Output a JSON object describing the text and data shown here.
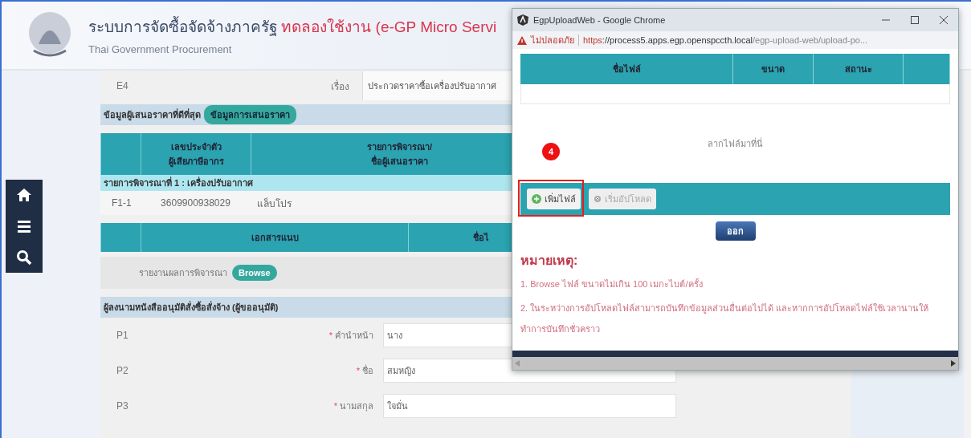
{
  "header": {
    "title": "ระบบการจัดซื้อจัดจ้างภาครัฐ",
    "title_highlight": "ทดลองใช้งาน (e-GP Micro Servi",
    "subtitle": "Thai Government Procurement"
  },
  "subject_row": {
    "code": "E4",
    "label": "เรื่อง",
    "value": "ประกวดราคาซื้อเครื่องปรับอากาศ"
  },
  "bidder_section": {
    "title": "ข้อมูลผู้เสนอราคาที่ดีที่สุด",
    "button": "ข้อมูลการเสนอราคา"
  },
  "bidder_table": {
    "columns": [
      "",
      "เลขประจำตัว\nผู้เสียภาษีอากร",
      "รายการพิจารณา/\nชื่อผู้เสนอราคา"
    ],
    "group": "รายการพิจารณาที่ 1 : เครื่องปรับอากาศ",
    "rows": [
      [
        "F1-1",
        "3609900938029",
        "แล็บโปร"
      ]
    ]
  },
  "attachments": {
    "columns": [
      "",
      "เอกสารแนบ",
      "ชื่อไ"
    ],
    "rows": [
      {
        "label": "รายงานผลการพิจารณา",
        "button": "Browse"
      }
    ]
  },
  "approver": {
    "title": "ผู้ลงนามหนังสืออนุมัติสั่งซื้อสั่งจ้าง (ผู้ขออนุมัติ)",
    "required_mark": "*",
    "fields": [
      {
        "code": "P1",
        "label": "คำนำหน้า",
        "required": true,
        "value": "นาง"
      },
      {
        "code": "P2",
        "label": "ชื่อ",
        "required": true,
        "value": "สมหญิง"
      },
      {
        "code": "P3",
        "label": "นามสกุล",
        "required": true,
        "value": "ใจมั่น"
      }
    ]
  },
  "popup": {
    "title": "EgpUploadWeb - Google Chrome",
    "security": "ไม่ปลอดภัย",
    "url_scheme": "https",
    "url_host": "://process5.apps.egp.openspccth.local",
    "url_path": "/egp-upload-web/upload-po...",
    "columns": [
      "ชื่อไฟล์",
      "ขนาด",
      "สถานะ"
    ],
    "drop_hint": "ลากไฟล์มาที่นี่",
    "step_badge": "4",
    "buttons": [
      {
        "label": "เพิ่มไฟล์",
        "disabled": false,
        "highlighted": true
      },
      {
        "label": "เริ่มอัปโหลด",
        "disabled": true,
        "highlighted": false
      }
    ],
    "exit_button": "ออก",
    "notes_title": "หมายเหตุ:",
    "notes": [
      "1. Browse ไฟล์ ขนาดไม่เกิน 100 เมกะไบต์/ครั้ง",
      "2. ในระหว่างการอัปโหลดไฟล์สามารถบันทึกข้อมูลส่วนอื่นต่อไปได้ และหากการอัปโหลดไฟล์ใช้เวลานานให้ทำการบันทึกชั่วคราว"
    ]
  }
}
